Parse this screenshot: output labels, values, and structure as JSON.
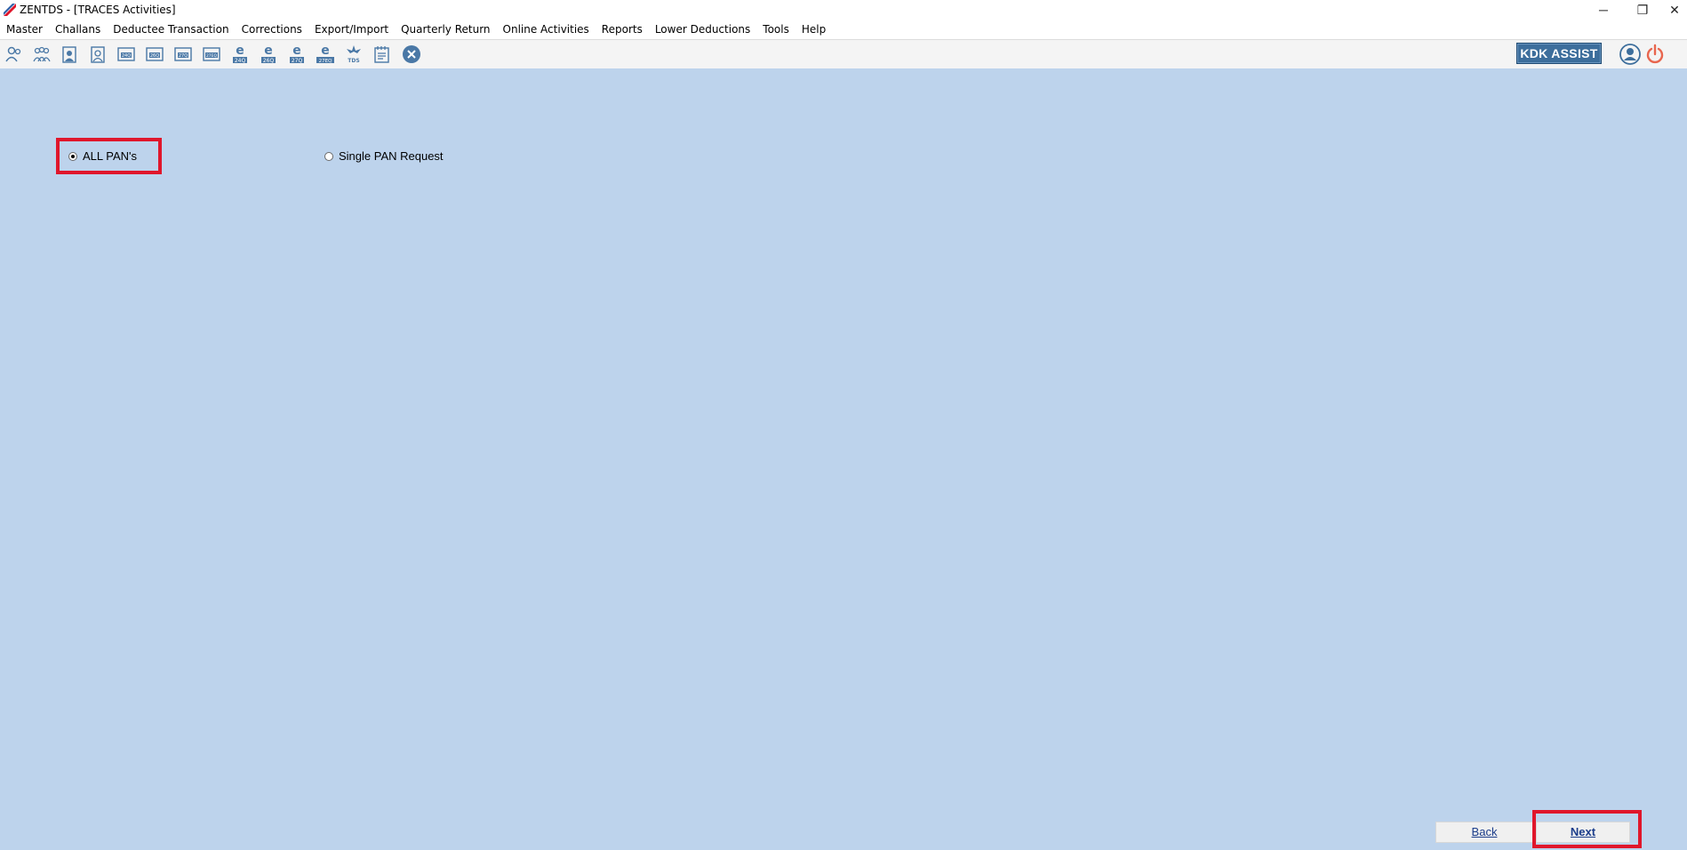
{
  "window": {
    "title": "ZENTDS - [TRACES Activities]",
    "minimize_glyph": "─",
    "restore_glyph": "❐",
    "close_glyph": "✕"
  },
  "menu": [
    "Master",
    "Challans",
    "Deductee Transaction",
    "Corrections",
    "Export/Import",
    "Quarterly Return",
    "Online Activities",
    "Reports",
    "Lower Deductions",
    "Tools",
    "Help"
  ],
  "toolbar": {
    "icons": [
      {
        "name": "deductor-icon",
        "label": ""
      },
      {
        "name": "deductees-icon",
        "label": ""
      },
      {
        "name": "employee-icon",
        "label": ""
      },
      {
        "name": "employee-salary-icon",
        "label": ""
      },
      {
        "name": "form-24q-icon",
        "label": "24Q"
      },
      {
        "name": "form-26q-icon",
        "label": "26Q"
      },
      {
        "name": "form-27q-icon",
        "label": "27Q"
      },
      {
        "name": "form-27eq-icon",
        "label": "27EQ"
      },
      {
        "name": "e-24q-icon",
        "label": "24Q"
      },
      {
        "name": "e-26q-icon",
        "label": "26Q"
      },
      {
        "name": "e-27q-icon",
        "label": "27Q"
      },
      {
        "name": "e-27eq-icon",
        "label": "27EQ"
      },
      {
        "name": "tds-icon",
        "label": "TDS"
      },
      {
        "name": "notepad-icon",
        "label": ""
      },
      {
        "name": "close-circle-icon",
        "label": ""
      }
    ],
    "kdk_assist_label": "KDK ASSIST",
    "user_icon": "user-icon",
    "power_icon": "power-icon"
  },
  "options": {
    "all_pans_label": "ALL PAN's",
    "single_pan_label": "Single PAN Request",
    "selected": "all_pans"
  },
  "buttons": {
    "back_label": "Back",
    "next_label": "Next"
  },
  "colors": {
    "content_bg": "#bdd3ec",
    "highlight": "#e0162b",
    "accent": "#3d6e9c",
    "power": "#e8664e"
  }
}
